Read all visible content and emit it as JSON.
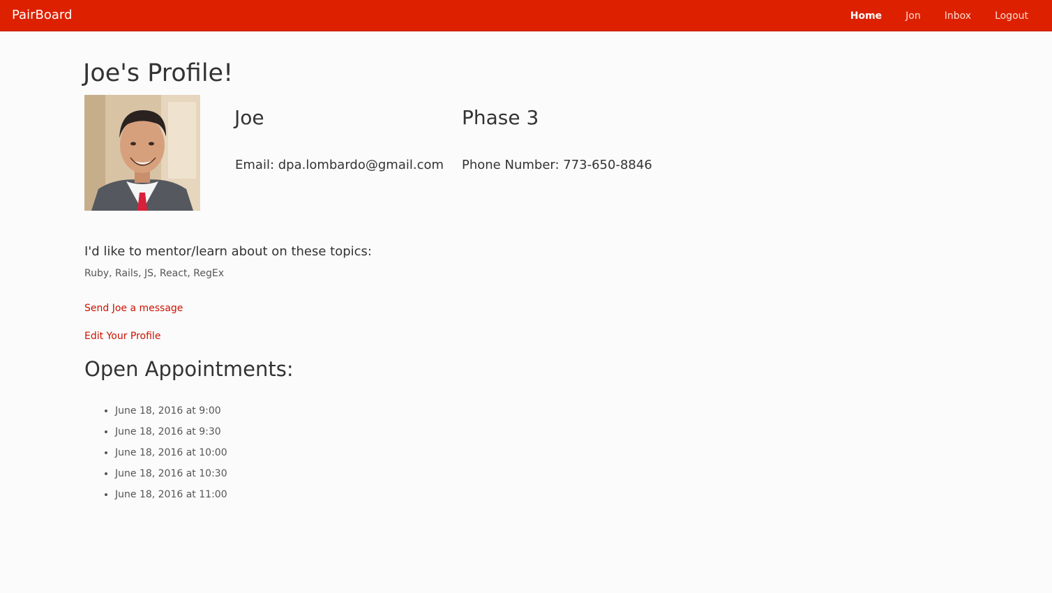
{
  "navbar": {
    "brand": "PairBoard",
    "links": [
      {
        "label": "Home",
        "active": true
      },
      {
        "label": "Jon",
        "active": false
      },
      {
        "label": "Inbox",
        "active": false
      },
      {
        "label": "Logout",
        "active": false
      }
    ],
    "bg_color": "#dd2100"
  },
  "profile": {
    "title": "Joe's Profile!",
    "name": "Joe",
    "phase": "Phase 3",
    "email": "Email: dpa.lombardo@gmail.com",
    "phone": "Phone Number: 773-650-8846",
    "avatar_icon": "user-photo"
  },
  "topics": {
    "heading": "I'd like to mentor/learn about on these topics:",
    "list": "Ruby, Rails, JS, React, RegEx"
  },
  "actions": {
    "send_message": "Send Joe a message",
    "edit_profile": "Edit Your Profile"
  },
  "appointments": {
    "heading": "Open Appointments:",
    "items": [
      "June 18, 2016 at 9:00",
      "June 18, 2016 at 9:30",
      "June 18, 2016 at 10:00",
      "June 18, 2016 at 10:30",
      "June 18, 2016 at 11:00"
    ]
  },
  "link_color": "#cc1100"
}
